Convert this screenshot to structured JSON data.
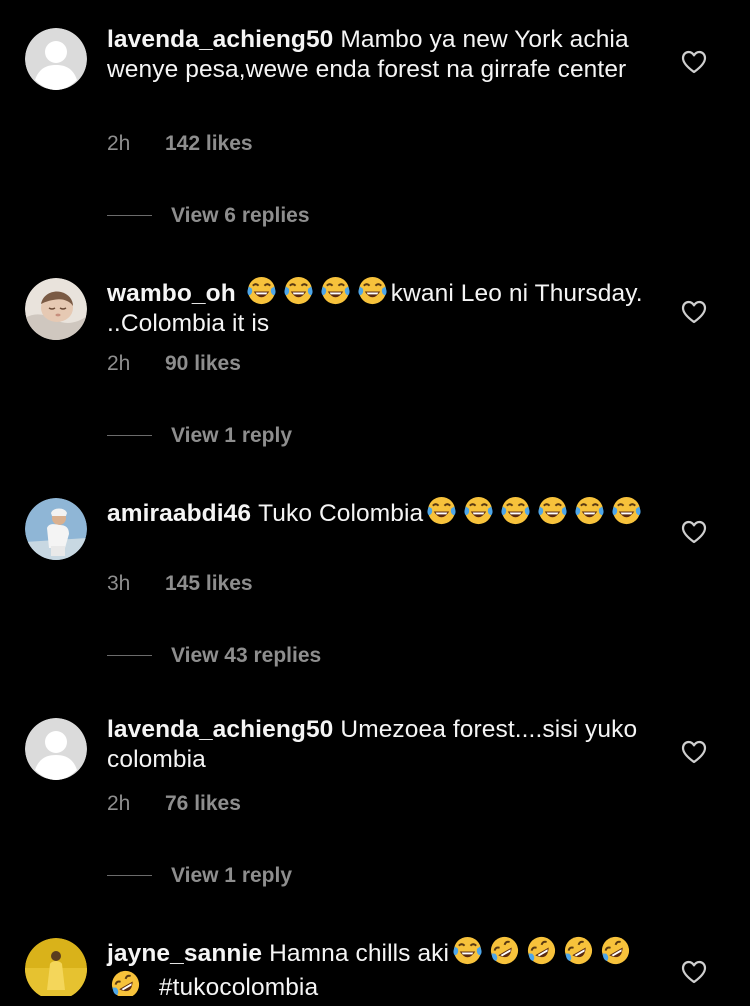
{
  "comments": [
    {
      "username": "lavenda_achieng50",
      "text_before": "Mambo ya new York achia wenye pesa,wewe enda forest  na girrafe center",
      "text_after": "",
      "time": "2h",
      "likes": "142 likes",
      "replies": "View 6 replies",
      "avatar": "default-avatar"
    },
    {
      "username": "wambo_oh",
      "text_before": "",
      "text_after": "kwani Leo ni Thursday. ..Colombia it is",
      "time": "2h",
      "likes": "90 likes",
      "replies": "View 1 reply",
      "avatar": "baby-photo-avatar"
    },
    {
      "username": "amiraabdi46",
      "text_before": "Tuko Colombia",
      "text_after": "",
      "time": "3h",
      "likes": "145 likes",
      "replies": "View 43 replies",
      "avatar": "person-photo-avatar"
    },
    {
      "username": "lavenda_achieng50",
      "text_before": "Umezoea forest....sisi yuko colombia",
      "text_after": "",
      "time": "2h",
      "likes": "76 likes",
      "replies": "View 1 reply",
      "avatar": "default-avatar"
    },
    {
      "username": "jayne_sannie",
      "text_before": "Hamna chills aki",
      "text_after": "#tukocolombia",
      "time": "",
      "likes": "",
      "replies": "",
      "avatar": "yellow-photo-avatar"
    }
  ],
  "icons": {
    "heart": "heart-outline-icon",
    "laugh": "face-with-tears-of-joy-emoji",
    "rofl": "rolling-on-floor-laughing-emoji"
  },
  "colors": {
    "background": "#000000",
    "primary_text": "#f5f5f5",
    "secondary_text": "#8e8e8e"
  }
}
